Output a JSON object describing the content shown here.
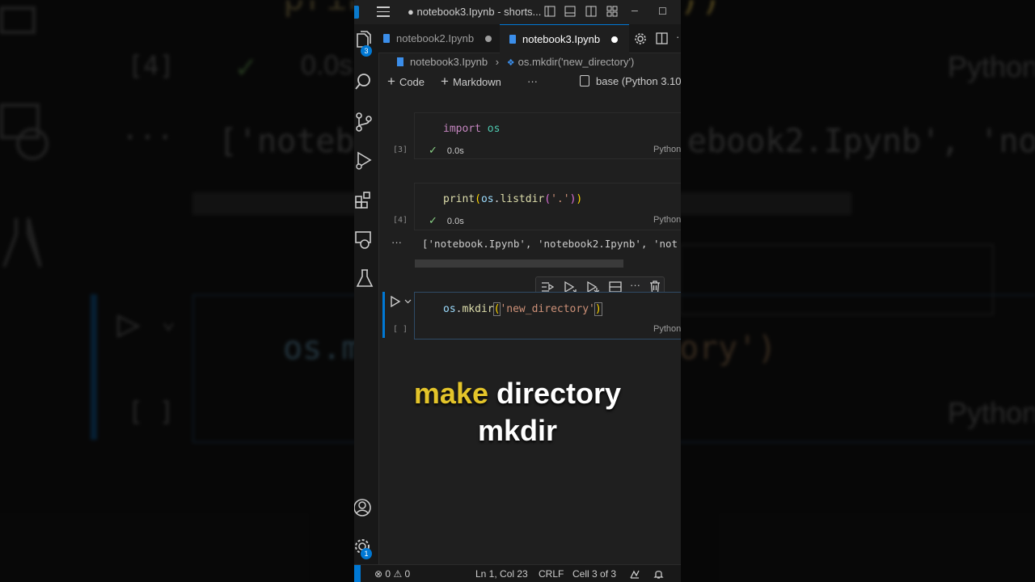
{
  "window": {
    "title": "● notebook3.Ipynb - shorts...",
    "minimize": "─",
    "maximize": "☐"
  },
  "activity_bar": {
    "explorer_badge": "3",
    "settings_badge": "1"
  },
  "tabs": [
    {
      "label": "notebook2.Ipynb",
      "dirty": "●"
    },
    {
      "label": "notebook3.Ipynb",
      "dirty": "●"
    }
  ],
  "breadcrumb": {
    "file": "notebook3.Ipynb",
    "separator": "›",
    "symbol": "os.mkdir('new_directory')"
  },
  "toolbar": {
    "code_label": "Code",
    "markdown_label": "Markdown",
    "more": "···",
    "kernel": "base (Python 3.10."
  },
  "cells": [
    {
      "exec_count": "[3]",
      "code_keyword": "import",
      "code_module": "os",
      "status_time": "0.0s",
      "language": "Python"
    },
    {
      "exec_count": "[4]",
      "code_func": "print",
      "code_open": "(",
      "code_obj": "os",
      "code_dot": ".",
      "code_method": "listdir",
      "code_open2": "(",
      "code_str": "'.'",
      "code_close2": ")",
      "code_close": ")",
      "status_time": "0.0s",
      "language": "Python",
      "output_marker": "···",
      "output": "['notebook.Ipynb', 'notebook2.Ipynb', 'not"
    },
    {
      "exec_count": "[ ]",
      "code_obj": "os",
      "code_dot": ".",
      "code_method": "mkdir",
      "code_open": "(",
      "code_str": "'new_directory'",
      "code_close": ")",
      "language": "Python"
    }
  ],
  "caption": {
    "line1_highlight": "make",
    "line1_rest": " directory",
    "line2": "mkdir"
  },
  "statusbar": {
    "errors": "0",
    "warnings": "0",
    "position": "Ln 1, Col 23",
    "eol": "CRLF",
    "cell_info": "Cell 3 of 3"
  },
  "background": {
    "exec4": "[4]",
    "time": "0.0s",
    "dots": "···",
    "out_left": "['noteb",
    "out_right": "ebook2.Ipynb', 'not",
    "lang": "Python",
    "code": "os.m",
    "code_right": "ory')",
    "empty": "[ ]",
    "print_frag": "prin",
    "paren_frag": "))"
  },
  "colors": {
    "accent": "#0078d4",
    "caption_highlight": "#e3c42a",
    "check": "#89d185",
    "dirty_dot": "#cccccc"
  }
}
